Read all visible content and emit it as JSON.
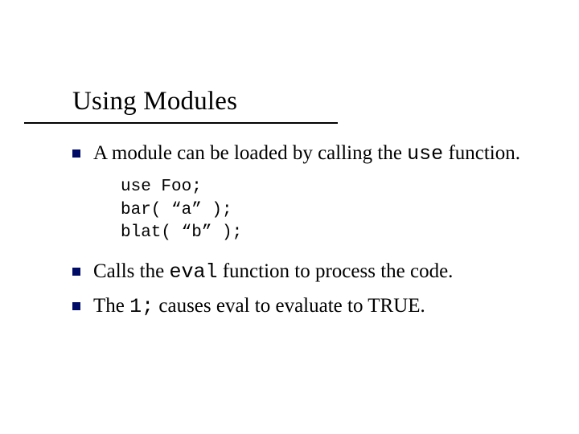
{
  "title": "Using Modules",
  "bullets": [
    {
      "segments": [
        {
          "text": "A module can be loaded by calling the ",
          "mono": false
        },
        {
          "text": "use",
          "mono": true
        },
        {
          "text": " function.",
          "mono": false
        }
      ]
    },
    {
      "segments": [
        {
          "text": "Calls the ",
          "mono": false
        },
        {
          "text": "eval",
          "mono": true
        },
        {
          "text": " function to process the code.",
          "mono": false
        }
      ]
    },
    {
      "segments": [
        {
          "text": "The ",
          "mono": false
        },
        {
          "text": "1;",
          "mono": true
        },
        {
          "text": " causes eval to evaluate to TRUE.",
          "mono": false
        }
      ]
    }
  ],
  "code_lines": [
    "use Foo;",
    "bar( “a” );",
    "blat( “b” );"
  ]
}
